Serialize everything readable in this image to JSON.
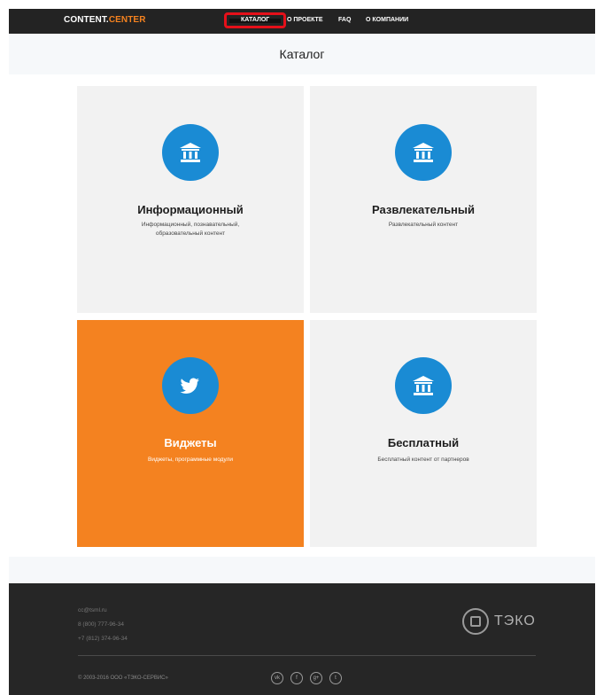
{
  "header": {
    "logo_main": "CONTENT.",
    "logo_accent": "CENTER",
    "nav": [
      {
        "label": "КАТАЛОГ"
      },
      {
        "label": "О ПРОЕКТЕ"
      },
      {
        "label": "FAQ"
      },
      {
        "label": "О КОМПАНИИ"
      }
    ]
  },
  "page": {
    "title": "Каталог"
  },
  "cards": [
    {
      "title": "Информационный",
      "description_line1": "Информационный, познавательный,",
      "description_line2": "образовательный контент",
      "icon": "bank-icon",
      "highlight": false
    },
    {
      "title": "Развлекательный",
      "description_line1": "Развлекательный контент",
      "description_line2": "",
      "icon": "bank-icon",
      "highlight": false
    },
    {
      "title": "Виджеты",
      "description_line1": "Виджеты, программные модули",
      "description_line2": "",
      "icon": "twitter-bird-icon",
      "highlight": true
    },
    {
      "title": "Бесплатный",
      "description_line1": "Бесплатный контент от партнеров",
      "description_line2": "",
      "icon": "bank-icon",
      "highlight": false
    }
  ],
  "footer": {
    "email": "cc@tsml.ru",
    "phone1": "8 (800) 777-96-34",
    "phone2": "+7 (812) 374-96-34",
    "brand_name": "ТЭКО",
    "copyright": "© 2003-2016 ООО «ТЭКО-СЕРВИС»",
    "social": [
      {
        "icon": "vk-icon",
        "glyph": "vk"
      },
      {
        "icon": "facebook-icon",
        "glyph": "f"
      },
      {
        "icon": "google-plus-icon",
        "glyph": "g+"
      },
      {
        "icon": "twitter-icon",
        "glyph": "t"
      }
    ]
  },
  "colors": {
    "accent_orange": "#f48220",
    "icon_blue": "#1a8bd4",
    "header_bg": "#232323",
    "footer_bg": "#262626",
    "highlight_red": "#e5101a"
  }
}
